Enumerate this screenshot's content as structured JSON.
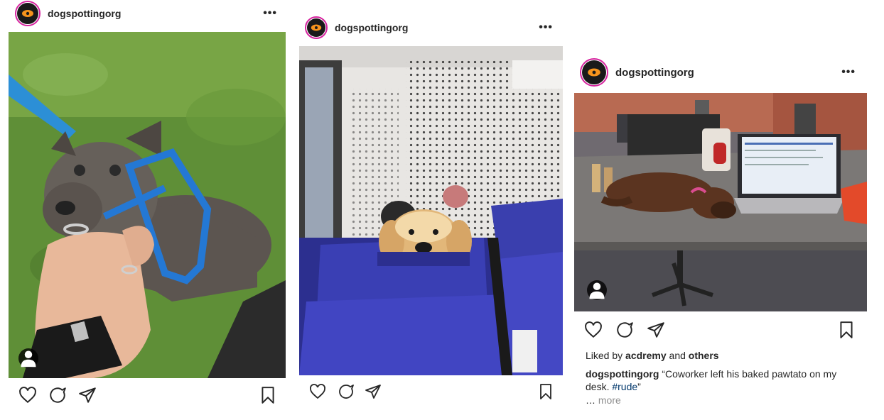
{
  "colors": {
    "accent_ring": "#d6249f",
    "hashtag": "#00376b",
    "muted": "#8e8e8e",
    "logo_orange": "#f7941d"
  },
  "posts": [
    {
      "username": "dogspottingorg",
      "more_icon": "more-horizontal-icon",
      "image_description": "blue pit bull puppy on grass biting a hand",
      "tagged_user_icon": "user-tag-icon"
    },
    {
      "username": "dogspottingorg",
      "more_icon": "more-horizontal-icon",
      "image_description": "golden retriever peeking over a blue train seat"
    },
    {
      "username": "dogspottingorg",
      "more_icon": "more-horizontal-icon",
      "image_description": "chocolate lab puppy sleeping on a desk next to a laptop",
      "tagged_user_icon": "user-tag-icon",
      "liked_by_prefix": "Liked by",
      "liked_by_user": "acdremy",
      "liked_by_and": "and",
      "liked_by_others": "others",
      "caption_user": "dogspottingorg",
      "caption_text": "“Coworker left his baked pawtato on my desk. ",
      "caption_hashtag": "#rude",
      "caption_end": "”",
      "more_prefix": "…",
      "more_label": "more"
    }
  ]
}
